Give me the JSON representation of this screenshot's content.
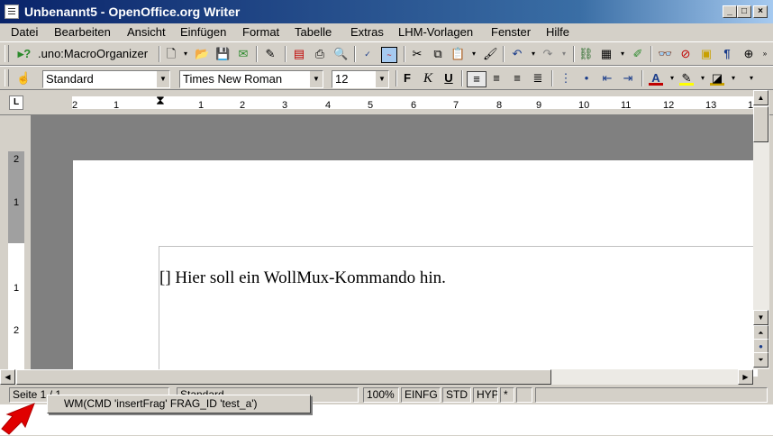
{
  "window": {
    "title": "Unbenannt5 - OpenOffice.org Writer"
  },
  "menu": [
    "Datei",
    "Bearbeiten",
    "Ansicht",
    "Einfügen",
    "Format",
    "Tabelle",
    "Extras",
    "LHM-Vorlagen",
    "Fenster",
    "Hilfe"
  ],
  "toolbar1": {
    "macro_label": ".uno:MacroOrganizer"
  },
  "format_toolbar": {
    "paragraph_style": "Standard",
    "font_name": "Times New Roman",
    "font_size": "12",
    "bold_label": "F",
    "italic_label": "K",
    "underline_label": "U"
  },
  "ruler": {
    "h_numbers": [
      "2",
      "1",
      "1",
      "2",
      "3",
      "4",
      "5",
      "6",
      "7",
      "8",
      "9",
      "10",
      "11",
      "12",
      "13",
      "1"
    ],
    "v_numbers": [
      "2",
      "1",
      "1",
      "2"
    ]
  },
  "document": {
    "text": "[] Hier soll ein WollMux-Kommando hin."
  },
  "status": {
    "page": "Seite 1 / 1",
    "style": "Standard",
    "zoom": "100%",
    "insert_mode": "EINFG",
    "selection_mode": "STD",
    "hyperlink_mode": "HYP",
    "modified": "*"
  },
  "popup": {
    "item": "WM(CMD 'insertFrag' FRAG_ID 'test_a')"
  },
  "colors": {
    "titlebar": "#0a246a",
    "chrome": "#d4d0c8",
    "docarea": "#808080",
    "arrow": "#e00000"
  }
}
